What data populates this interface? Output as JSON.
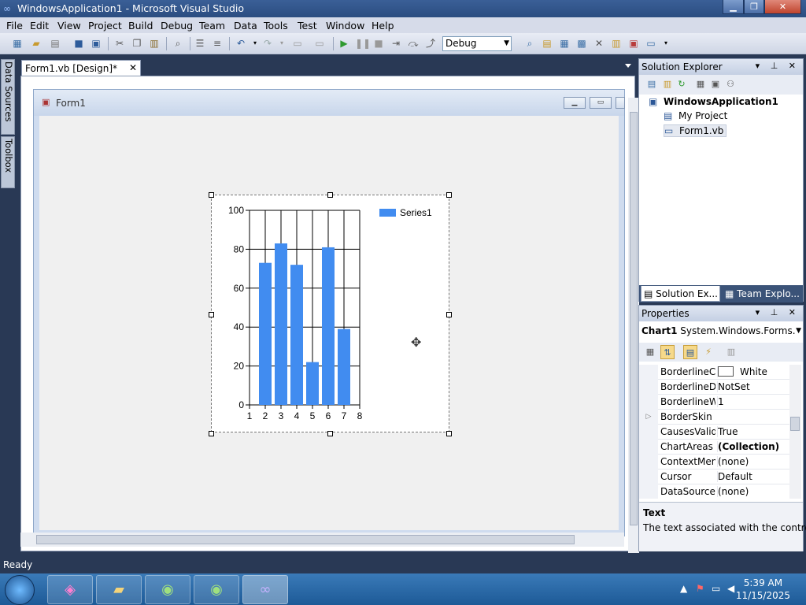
{
  "window": {
    "title": "WindowsApplication1 - Microsoft Visual Studio"
  },
  "menu": [
    "File",
    "Edit",
    "View",
    "Project",
    "Build",
    "Debug",
    "Team",
    "Data",
    "Tools",
    "Test",
    "Window",
    "Help"
  ],
  "toolbar": {
    "config": "Debug"
  },
  "side_tabs": {
    "data_sources": "Data Sources",
    "toolbox": "Toolbox"
  },
  "document": {
    "tab_label": "Form1.vb [Design]*",
    "form_title": "Form1"
  },
  "chart_data": {
    "type": "bar",
    "x": [
      2,
      3,
      4,
      5,
      6,
      7
    ],
    "values": [
      73,
      83,
      72,
      22,
      81,
      39
    ],
    "xticks": [
      "1",
      "2",
      "3",
      "4",
      "5",
      "6",
      "7",
      "8"
    ],
    "yticks": [
      "0",
      "20",
      "40",
      "60",
      "80",
      "100"
    ],
    "xlim": [
      1,
      8
    ],
    "ylim": [
      0,
      100
    ],
    "grid": true,
    "legend_position": "top-right",
    "series": [
      {
        "name": "Series1",
        "color": "#418cf0"
      }
    ],
    "title": "",
    "xlabel": "",
    "ylabel": ""
  },
  "solution_explorer": {
    "title": "Solution Explorer",
    "items": [
      "WindowsApplication1",
      "My Project",
      "Form1.vb"
    ],
    "tabs": [
      "Solution Ex...",
      "Team Explo..."
    ]
  },
  "properties": {
    "title": "Properties",
    "object_name": "Chart1",
    "object_type": "System.Windows.Forms.Da",
    "rows": [
      {
        "name": "BorderlineCc",
        "value": "White"
      },
      {
        "name": "BorderlineDa",
        "value": "NotSet"
      },
      {
        "name": "BorderlineWi",
        "value": "1"
      },
      {
        "name": "BorderSkin",
        "value": ""
      },
      {
        "name": "CausesValida",
        "value": "True"
      },
      {
        "name": "ChartAreas",
        "value": "(Collection)"
      },
      {
        "name": "ContextMenu",
        "value": "(none)"
      },
      {
        "name": "Cursor",
        "value": "Default"
      },
      {
        "name": "DataSource",
        "value": "(none)"
      }
    ],
    "desc_title": "Text",
    "desc_text": "The text associated with the control."
  },
  "status": {
    "text": "Ready"
  },
  "taskbar": {
    "time": "5:39 AM",
    "date": "11/15/2025"
  }
}
